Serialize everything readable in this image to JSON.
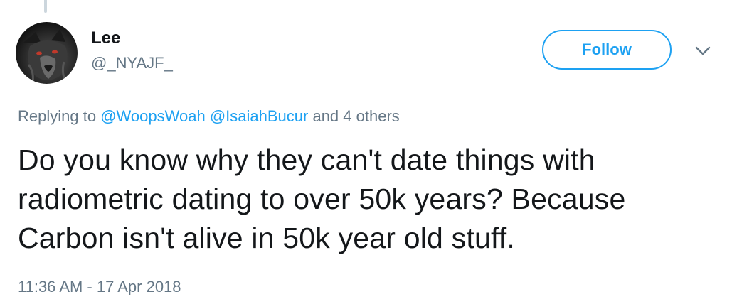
{
  "tweet": {
    "author": {
      "display_name": "Lee",
      "screen_name": "@_NYAJF_",
      "avatar": "dark-wolf-avatar"
    },
    "follow_label": "Follow",
    "more_icon": "chevron-down-icon",
    "replying": {
      "prefix": "Replying to",
      "mentions": [
        "@WoopsWoah",
        "@IsaiahBucur"
      ],
      "suffix": "and 4 others"
    },
    "text": "Do you know why they can't date things with radiometric dating to over 50k years? Because Carbon isn't alive in 50k year old stuff.",
    "timestamp": "11:36 AM - 17 Apr 2018"
  },
  "colors": {
    "accent": "#1da1f2",
    "secondary_text": "#657786",
    "primary_text": "#14171a",
    "thread_line": "#ccd6dd"
  }
}
